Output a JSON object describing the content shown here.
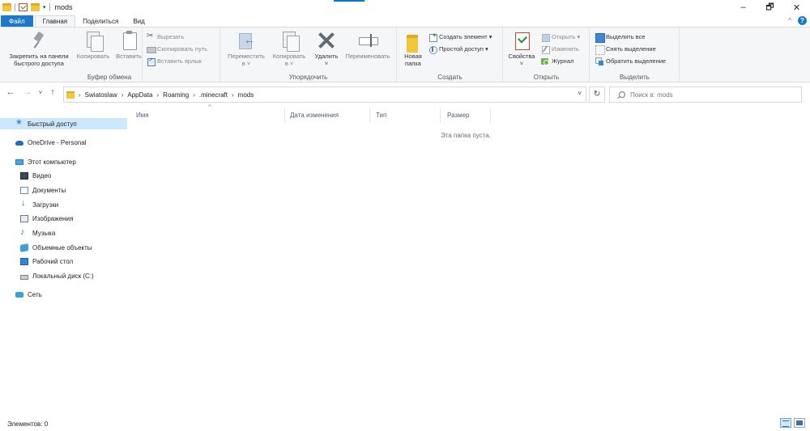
{
  "window": {
    "title": "mods",
    "minimize": "–",
    "maximize": "🗗",
    "close": "✕"
  },
  "ribbon_tabs": [
    "Файл",
    "Главная",
    "Поделиться",
    "Вид"
  ],
  "ribbon_controls": {
    "collapse": "^",
    "help": "?"
  },
  "clipboard": {
    "pin_label_1": "Закрепить на панели",
    "pin_label_2": "быстрого доступа",
    "copy": "Копировать",
    "paste": "Вставить",
    "cut": "Вырезать",
    "copy_path": "Скопировать путь",
    "paste_shortcut": "Вставить ярлык",
    "group_label": "Буфер обмена"
  },
  "organize": {
    "move_to": "Переместить",
    "move_to_2": "в ˅",
    "copy_to": "Копировать",
    "copy_to_2": "в ˅",
    "delete": "Удалить",
    "delete_2": "˅",
    "rename": "Переименовать",
    "group_label": "Упорядочить"
  },
  "new_group": {
    "new_folder_1": "Новая",
    "new_folder_2": "папка",
    "new_item": "Создать элемент ▾",
    "easy_access": "Простой доступ ▾",
    "group_label": "Создать"
  },
  "open_group": {
    "properties": "Свойства",
    "properties_2": "˅",
    "open": "Открыть ▾",
    "edit": "Изменить",
    "history": "Журнал",
    "group_label": "Открыть"
  },
  "select_group": {
    "select_all": "Выделить все",
    "select_none": "Снять выделение",
    "invert": "Обратить выделение",
    "group_label": "Выделить"
  },
  "nav": {
    "back": "←",
    "forward": "→",
    "recent": "˅",
    "up": "↑",
    "breadcrumbs": [
      "Swiatoslaw",
      "AppData",
      "Roaming",
      ".minecraft",
      "mods"
    ],
    "dropdown": "˅",
    "refresh": "↻",
    "search_placeholder": "Поиск в: mods"
  },
  "sidebar": {
    "quick_access": "Быстрый доступ",
    "onedrive": "OneDrive - Personal",
    "this_pc": "Этот компьютер",
    "pc_items": [
      "Видео",
      "Документы",
      "Загрузки",
      "Изображения",
      "Музыка",
      "Объемные объекты",
      "Рабочий стол",
      "Локальный диск (C:)"
    ],
    "network": "Сеть"
  },
  "file_list": {
    "columns": [
      "Имя",
      "Дата изменения",
      "Тип",
      "Размер"
    ],
    "sort_indicator": "^",
    "empty_message": "Эта папка пуста."
  },
  "status": {
    "items_count": "Элементов: 0"
  }
}
